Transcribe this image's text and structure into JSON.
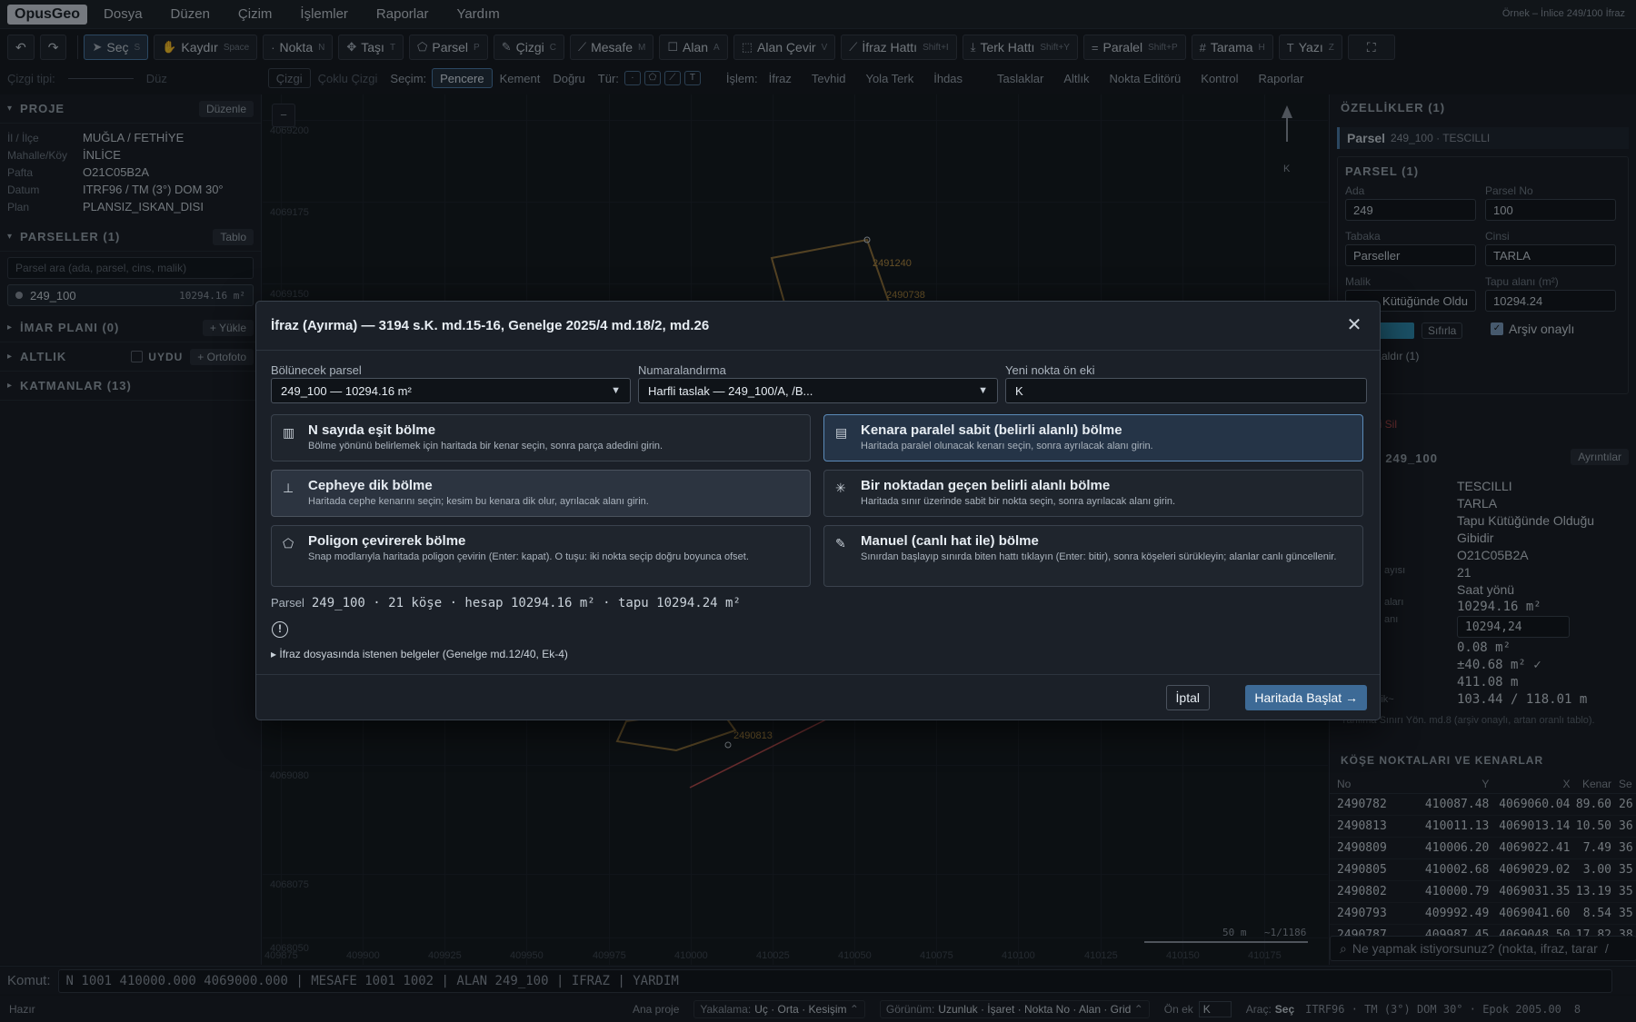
{
  "app": {
    "logo": "OpusGeo",
    "window_title": "Örnek – İnlice 249/100 İfraz"
  },
  "menu": [
    "Dosya",
    "Düzen",
    "Çizim",
    "İşlemler",
    "Raporlar",
    "Yardım"
  ],
  "toolbar": {
    "undo": "↶",
    "redo": "↷",
    "tools": [
      {
        "icon": "➤",
        "label": "Seç",
        "key": "S"
      },
      {
        "icon": "✋",
        "label": "Kaydır",
        "key": "Space"
      },
      {
        "icon": "·",
        "label": "Nokta",
        "key": "N"
      },
      {
        "icon": "✥",
        "label": "Taşı",
        "key": "T"
      },
      {
        "icon": "⬠",
        "label": "Parsel",
        "key": "P"
      },
      {
        "icon": "✎",
        "label": "Çizgi",
        "key": "C"
      },
      {
        "icon": "⟋",
        "label": "Mesafe",
        "key": "M"
      },
      {
        "icon": "☐",
        "label": "Alan",
        "key": "A"
      },
      {
        "icon": "⬚",
        "label": "Alan Çevir",
        "key": "V"
      },
      {
        "icon": "⟋",
        "label": "İfraz Hattı",
        "key": "Shift+I"
      },
      {
        "icon": "⤓",
        "label": "Terk Hattı",
        "key": "Shift+Y"
      },
      {
        "icon": "=",
        "label": "Paralel",
        "key": "Shift+P"
      },
      {
        "icon": "#",
        "label": "Tarama",
        "key": "H"
      },
      {
        "icon": "T",
        "label": "Yazı",
        "key": "Z"
      }
    ],
    "fullscreen": "⛶"
  },
  "subbar": {
    "line_type_label": "Çizgi tipi:",
    "line_type_value": "Düz",
    "cizgi": "Çizgi",
    "coklu": "Çoklu Çizgi",
    "secim_label": "Seçim:",
    "pencere": "Pencere",
    "kement": "Kement",
    "dogru": "Doğru",
    "tur_label": "Tür:",
    "islem_label": "İşlem:",
    "islem_items": [
      "İfraz",
      "Tevhid",
      "Yola Terk",
      "İhdas"
    ],
    "right_items": [
      "Taslaklar",
      "Altlık",
      "Nokta Editörü",
      "Kontrol",
      "Raporlar"
    ]
  },
  "left": {
    "proje": {
      "title": "PROJE",
      "button": "Düzenle",
      "rows": [
        {
          "k": "İl / İlçe",
          "v": "MUĞLA / FETHİYE"
        },
        {
          "k": "Mahalle/Köy",
          "v": "İNLİCE"
        },
        {
          "k": "Pafta",
          "v": "O21C05B2A"
        },
        {
          "k": "Datum",
          "v": "ITRF96 / TM (3°) DOM 30°"
        },
        {
          "k": "Plan",
          "v": "PLANSIZ_ISKAN_DISI"
        }
      ]
    },
    "parseller": {
      "title": "PARSELLER (1)",
      "button": "Tablo",
      "search_placeholder": "Parsel ara (ada, parsel, cins, malik)",
      "item": {
        "name": "249_100",
        "area": "10294.16 m²"
      }
    },
    "imar": {
      "title": "İMAR PLANI (0)",
      "button": "+ Yükle"
    },
    "altlik": {
      "title": "ALTLIK",
      "checkbox": "UYDU",
      "button": "+ Ortofoto"
    },
    "katmanlar": {
      "title": "KATMANLAR (13)"
    }
  },
  "map": {
    "y_labels": [
      "4069200",
      "4069175",
      "4069150",
      "4069080",
      "4068075",
      "4068050"
    ],
    "x_labels": [
      "409875",
      "409900",
      "409925",
      "409950",
      "409975",
      "410000",
      "410025",
      "410050",
      "410075",
      "410100",
      "410125",
      "410150",
      "410175"
    ],
    "points": [
      "2491240",
      "2490738",
      "2490813"
    ],
    "north": "K",
    "scale": "50 m",
    "ratio": "~1/1186"
  },
  "right": {
    "title": "ÖZELLİKLER (1)",
    "tag": {
      "name": "Parsel",
      "sub": "249_100 · TESCILLI"
    },
    "box_title": "PARSEL (1)",
    "fields": {
      "ada_l": "Ada",
      "ada": "249",
      "parsel_l": "Parsel No",
      "parsel": "100",
      "tabaka_l": "Tabaka",
      "tabaka": "Parseller",
      "cins_l": "Cinsi",
      "cins": "TARLA",
      "malik_l": "Malik",
      "malik": "Kütüğünde Oldu",
      "tapu_l": "Tapu alanı (m²)",
      "tapu": "10294.24",
      "sifirla": "Sıfırla",
      "arsiv": "Arşiv onaylı",
      "kaldir": "Kaldır (1)"
    },
    "sil": "ni Sil",
    "detail_title": "L 249_100",
    "detail_btn": "Ayrıntılar",
    "detail": [
      "TESCILLI",
      "TARLA",
      "Tapu Kütüğünde Olduğu",
      "Gibidir",
      "O21C05B2A",
      "21",
      "Saat yönü",
      "10294.16 m²"
    ],
    "detail_input": "10294,24",
    "detail_more": [
      "0.08 m²",
      "±40.68 m² ✓",
      "411.08 m",
      "103.44 / 118.01 m"
    ],
    "detail_labels": [
      "ayısı",
      "aları",
      "anı",
      "~ / Derinlik~"
    ],
    "note": "Yanılma Sınırı Yön. md.8 (arşiv onaylı, artan oranlı tablo).",
    "corners_title": "KÖŞE NOKTALARI VE KENARLAR",
    "table_head": [
      "No",
      "Y",
      "X",
      "Kenar",
      "Se"
    ],
    "rows": [
      [
        "2490782",
        "410087.48",
        "4069060.04",
        "89.60",
        "26"
      ],
      [
        "2490813",
        "410011.13",
        "4069013.14",
        "10.50",
        "36"
      ],
      [
        "2490809",
        "410006.20",
        "4069022.41",
        "7.49",
        "36"
      ],
      [
        "2490805",
        "410002.68",
        "4069029.02",
        "3.00",
        "35"
      ],
      [
        "2490802",
        "410000.79",
        "4069031.35",
        "13.19",
        "35"
      ],
      [
        "2490793",
        "409992.49",
        "4069041.60",
        "8.54",
        "35"
      ],
      [
        "2490787",
        "409987.45",
        "4069048.50",
        "17.82",
        "38"
      ]
    ],
    "ask_placeholder": "Ne yapmak istiyorsunuz? (nokta, ifraz, tarar",
    "ask_key": "/"
  },
  "command": {
    "label": "Komut:",
    "value": "N 1001 410000.000 4069000.000  |  MESAFE 1001 1002  |  ALAN 249_100  |  IFRAZ  |  YARDIM"
  },
  "status": {
    "ready": "Hazır",
    "project": "Ana proje",
    "snap_l": "Yakalama:",
    "snap": "Uç · Orta · Kesişim",
    "view_l": "Görünüm:",
    "view": "Uzunluk · İşaret · Nokta No · Alan · Grid",
    "prefix_l": "Ön ek",
    "prefix": "K",
    "tool_l": "Araç:",
    "tool": "Seç",
    "crs": "ITRF96 · TM (3°) DOM 30° · Epok 2005.00",
    "tail": "8"
  },
  "modal": {
    "title": "İfraz (Ayırma) — 3194 s.K. md.15-16, Genelge 2025/4 md.18/2, md.26",
    "close": "✕",
    "f1_label": "Bölünecek parsel",
    "f1_value": "249_100 — 10294.16 m²",
    "f2_label": "Numaralandırma",
    "f2_value": "Harfli taslak — 249_100/A, /B...",
    "f3_label": "Yeni nokta ön eki",
    "f3_value": "K",
    "options": [
      {
        "icon": "▥",
        "title": "N sayıda eşit bölme",
        "desc": "Bölme yönünü belirlemek için haritada bir kenar seçin, sonra parça adedini girin."
      },
      {
        "icon": "▤",
        "title": "Kenara paralel sabit (belirli alanlı) bölme",
        "desc": "Haritada paralel olunacak kenarı seçin, sonra ayrılacak alanı girin."
      },
      {
        "icon": "⊥",
        "title": "Cepheye dik bölme",
        "desc": "Haritada cephe kenarını seçin; kesim bu kenara dik olur, ayrılacak alanı girin."
      },
      {
        "icon": "✳",
        "title": "Bir noktadan geçen belirli alanlı bölme",
        "desc": "Haritada sınır üzerinde sabit bir nokta seçin, sonra ayrılacak alanı girin."
      },
      {
        "icon": "⬠",
        "title": "Poligon çevirerek bölme",
        "desc": "Snap modlarıyla haritada poligon çevirin (Enter: kapat). O tuşu: iki nokta seçip doğru boyunca ofset."
      },
      {
        "icon": "✎",
        "title": "Manuel (canlı hat ile) bölme",
        "desc": "Sınırdan başlayıp sınırda biten hattı tıklayın (Enter: bitir), sonra köşeleri sürükleyin; alanlar canlı güncellenir."
      }
    ],
    "parcel_label": "Parsel",
    "parcel_info": "249_100 · 21 köşe · hesap 10294.16 m² · tapu 10294.24 m²",
    "warn": "!",
    "docs": "▸ İfraz dosyasında istenen belgeler (Genelge md.12/40, Ek-4)",
    "cancel": "İptal",
    "start": "Haritada Başlat →"
  },
  "colors": {
    "accent": "#3d6a96",
    "parcel_line": "#b38a3e",
    "cut_line": "#b84a4a"
  }
}
